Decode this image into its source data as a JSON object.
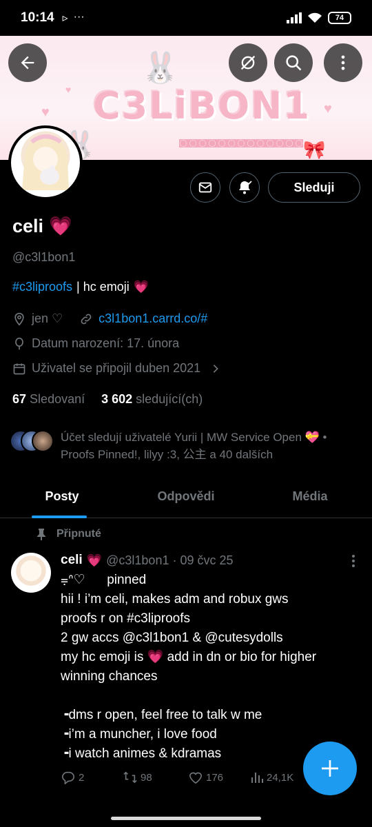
{
  "status_bar": {
    "time": "10:14",
    "icons_left": [
      "▹",
      "···"
    ],
    "battery": "74"
  },
  "profile": {
    "name": "celi",
    "name_emoji": "💗",
    "handle": "@c3l1bon1",
    "bio_hashtag": "#c3liproofs",
    "bio_text": "| hc emoji",
    "bio_emoji": "💗",
    "location": "jen ♡",
    "website": "c3l1bon1.carrd.co/#",
    "birthday": "Datum narození: 17. února",
    "joined": "Uživatel se připojil duben 2021",
    "following_count": "67",
    "following_label": "Sledovaní",
    "followers_count": "3 602",
    "followers_label": "sledující(ch)",
    "followed_by": "Účet sledují uživatelé Yurii | MW Service Open 💝 • Proofs Pinned!, lilyy :3, 公主 a 40 dalších"
  },
  "banner": {
    "logo_text": "C3LiBON1"
  },
  "buttons": {
    "follow": "Sleduji"
  },
  "tabs": [
    {
      "label": "Posty",
      "active": true
    },
    {
      "label": "Odpovědi",
      "active": false
    },
    {
      "label": "Média",
      "active": false
    }
  ],
  "pinned_label": "Připnuté",
  "post": {
    "name": "celi",
    "name_emoji": "💗",
    "handle_date": "@c3l1bon1 · 09 čvc 25",
    "lines": [
      "⩦ᐢ♡      pinned",
      "hii ! i’m celi, makes adm and robux gws",
      "proofs r on #c3liproofs",
      "2 gw accs @c3l1bon1 & @cutesydolls",
      "my hc emoji is 💗 add in dn or bio for higher",
      "winning chances",
      "",
      "╺dms r open, feel free to talk w me",
      "╺i’m a muncher, i love food",
      "╺i watch animes & kdramas"
    ],
    "replies": "2",
    "reposts": "98",
    "likes": "176",
    "views": "24,1K"
  },
  "colors": {
    "accent": "#1d9bf0",
    "muted": "#71767b",
    "heart": "#e0245e"
  }
}
